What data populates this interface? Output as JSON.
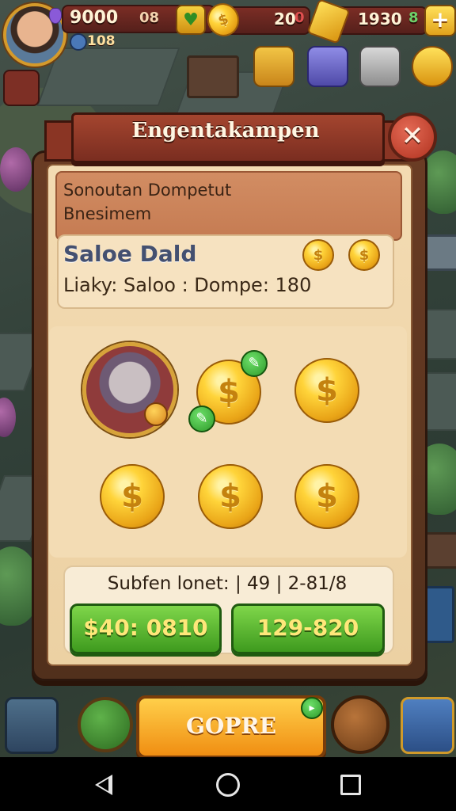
{
  "hud": {
    "player_value": "9000",
    "player_sub": "108",
    "meter_label": "08",
    "coin_value": "20",
    "coin_marker": "0",
    "gem_value": "1930",
    "gem_marker": "8",
    "plus_label": "+"
  },
  "dialog": {
    "title": "Engentakampen",
    "close_label": "✕",
    "description": [
      "Sonoutan Dompetut",
      "Bnesimem"
    ],
    "balance_title": "Saloe Dald",
    "balance_line": "Liaky: Saloo  :  Dompe: 180",
    "currency_symbol": "$",
    "payout_label": "Subfen lonet: | 49 | 2-81/8",
    "buttons": [
      "$40: 0810",
      "129-820"
    ]
  },
  "dock": {
    "main_label": "GOPRE"
  },
  "colors": {
    "panel_wood": "#6a3c24",
    "parchment": "#f3dbb2",
    "title_red": "#a4452f",
    "green_button": "#3e9a1e",
    "gold": "#ffd43a"
  }
}
